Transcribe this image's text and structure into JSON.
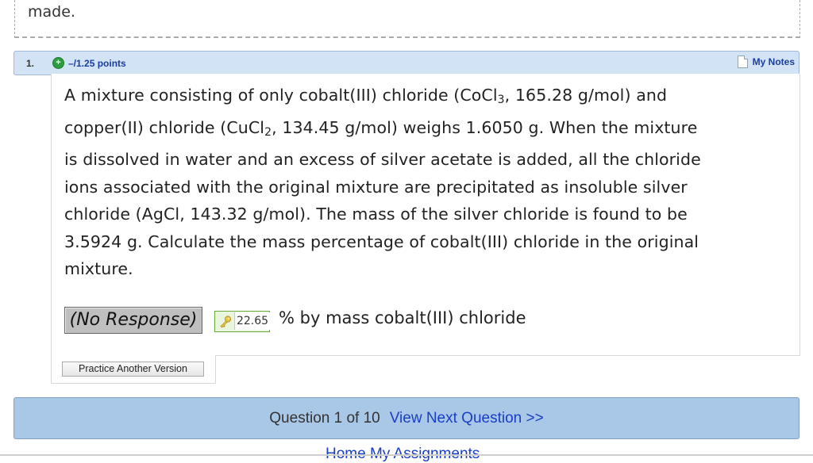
{
  "previous_fragment": "made.",
  "question": {
    "number": "1.",
    "points": "–/1.25 points",
    "my_notes_label": "My Notes",
    "text_lines": {
      "l1a": "A mixture consisting of only cobalt(III) chloride (CoCl",
      "l1sub": "3",
      "l1b": ", 165.28 g/mol) and",
      "l2a": "copper(II) chloride (CuCl",
      "l2sub": "2",
      "l2b": ", 134.45 g/mol) weighs 1.6050 g. When the mixture",
      "l3": "is dissolved in water and an excess of silver acetate is added, all the chloride",
      "l4": "ions associated with the original mixture are precipitated as insoluble silver",
      "l5": "chloride (AgCl, 143.32 g/mol). The mass of the silver chloride is found to be",
      "l6": "3.5924 g. Calculate the mass percentage of cobalt(III) chloride in the original",
      "l7": "mixture."
    },
    "answer": {
      "response": "(No Response)",
      "key_value": "22.65",
      "unit": "% by mass cobalt(III) chloride"
    },
    "practice_button": "Practice Another Version"
  },
  "nav": {
    "count": "Question 1 of 10",
    "next": "View Next Question >>"
  },
  "footer_links": "Home  My Assignments",
  "icons": [
    "plus-circle-icon",
    "notes-doc-icon",
    "key-icon"
  ],
  "colors": {
    "header_bg": "#d2e3f5",
    "nav_bg": "#a9c7e6",
    "link": "#1a3ec4",
    "plus": "#2e9b3f"
  }
}
